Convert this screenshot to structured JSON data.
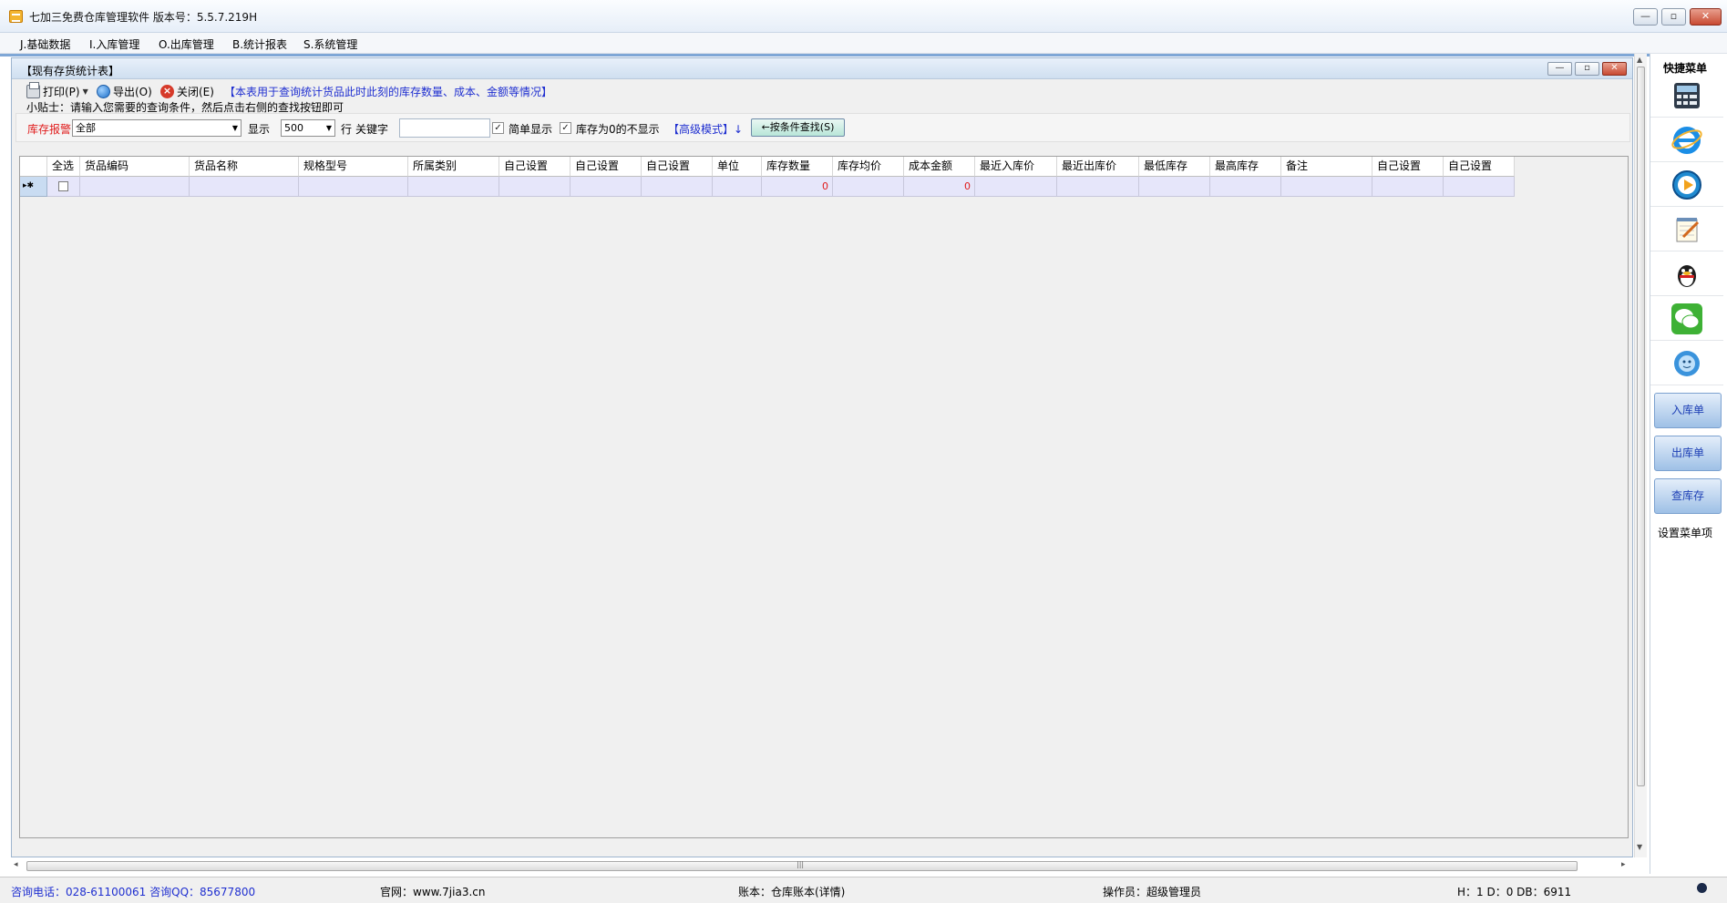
{
  "app": {
    "title": "七加三免费仓库管理软件 版本号：5.5.7.219H"
  },
  "menu": [
    {
      "label": "J.基础数据"
    },
    {
      "label": "I.入库管理"
    },
    {
      "label": "O.出库管理"
    },
    {
      "label": "B.统计报表"
    },
    {
      "label": "S.系统管理"
    }
  ],
  "child_window": {
    "title": "【现有存货统计表】",
    "toolbar": {
      "print_label": "打印(P)",
      "export_label": "导出(O)",
      "close_label": "关闭(E)",
      "note": "【本表用于查询统计货品此时此刻的库存数量、成本、金额等情况】"
    },
    "tip": "小贴士：请输入您需要的查询条件，然后点击右侧的查找按钮即可",
    "filter": {
      "stock_alarm_label": "库存报警",
      "stock_alarm_value": "全部",
      "show_label": "显示",
      "show_value": "500",
      "rows_label": "行",
      "keyword_label": "关键字",
      "keyword_value": "",
      "simple_display_label": "简单显示",
      "simple_display_checked": true,
      "hide_zero_label": "库存为0的不显示",
      "hide_zero_checked": true,
      "advanced_label": "【高级模式】↓",
      "search_button_label": "←按条件查找(S)"
    },
    "grid": {
      "columns": [
        "全选",
        "货品编码",
        "货品名称",
        "规格型号",
        "所属类别",
        "自己设置",
        "自己设置",
        "自己设置",
        "单位",
        "库存数量",
        "库存均价",
        "成本金额",
        "最近入库价",
        "最近出库价",
        "最低库存",
        "最高库存",
        "备注",
        "自己设置",
        "自己设置"
      ],
      "new_row_marker": "▸✱",
      "row": {
        "stock_qty": "0",
        "cost_amount": "0"
      }
    }
  },
  "quick_menu": {
    "title": "快捷菜单",
    "icons": [
      "calculator-icon",
      "ie-icon",
      "media-player-icon",
      "notepad-icon",
      "qq-icon",
      "wechat-icon",
      "online-service-icon"
    ],
    "buttons": [
      {
        "label": "入库单"
      },
      {
        "label": "出库单"
      },
      {
        "label": "查库存"
      }
    ],
    "settings_label": "设置菜单项"
  },
  "status": {
    "contact": "咨询电话：028-61100061 咨询QQ：85677800",
    "website": "官网：www.7jia3.cn",
    "account": "账本：仓库账本(详情)",
    "operator": "操作员：超级管理员",
    "db_info": "H：1 D：0 DB：6911"
  },
  "colors": {
    "link_blue": "#1f2fd0",
    "alarm_red": "#e01b1b",
    "row_lavender": "#e6e6fa",
    "quick_button_blue": "#9ec0e6"
  }
}
